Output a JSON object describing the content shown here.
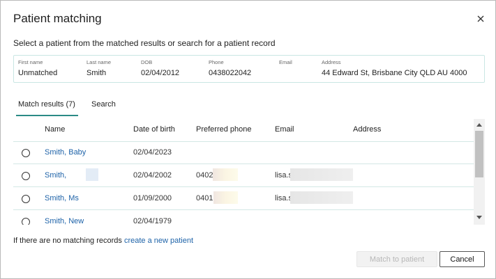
{
  "dialog": {
    "title": "Patient matching",
    "subtitle": "Select a patient from the matched results or search for a patient record",
    "close_icon": "close-icon"
  },
  "summary": {
    "first_name": {
      "label": "First name",
      "value": "Unmatched"
    },
    "last_name": {
      "label": "Last name",
      "value": "Smith"
    },
    "dob": {
      "label": "DOB",
      "value": "02/04/2012"
    },
    "phone": {
      "label": "Phone",
      "value": "0438022042"
    },
    "email": {
      "label": "Email",
      "value": ""
    },
    "address": {
      "label": "Address",
      "value": "44 Edward St, Brisbane City QLD AU 4000"
    }
  },
  "tabs": {
    "match_results": "Match results (7)",
    "search": "Search",
    "active": "match_results"
  },
  "table": {
    "headers": {
      "name": "Name",
      "dob": "Date of birth",
      "phone": "Preferred phone",
      "email": "Email",
      "address": "Address"
    },
    "rows": [
      {
        "name": "Smith, Baby",
        "dob": "02/04/2023",
        "phone": "",
        "email": "",
        "address": ""
      },
      {
        "name": "Smith,",
        "dob": "02/04/2002",
        "phone": "0402",
        "email": "lisa.s",
        "address": ""
      },
      {
        "name": "Smith, Ms",
        "dob": "01/09/2000",
        "phone": "0401",
        "email": "lisa.s",
        "address": ""
      },
      {
        "name": "Smith, New",
        "dob": "02/04/1979",
        "phone": "",
        "email": "",
        "address": ""
      }
    ]
  },
  "footer": {
    "no_match_text": "If there are no matching records ",
    "create_link": "create a new patient",
    "match_button": "Match to patient",
    "cancel_button": "Cancel"
  },
  "colors": {
    "accent": "#2a8a86",
    "link": "#1d62a8",
    "row_border": "#d3e7e5"
  }
}
